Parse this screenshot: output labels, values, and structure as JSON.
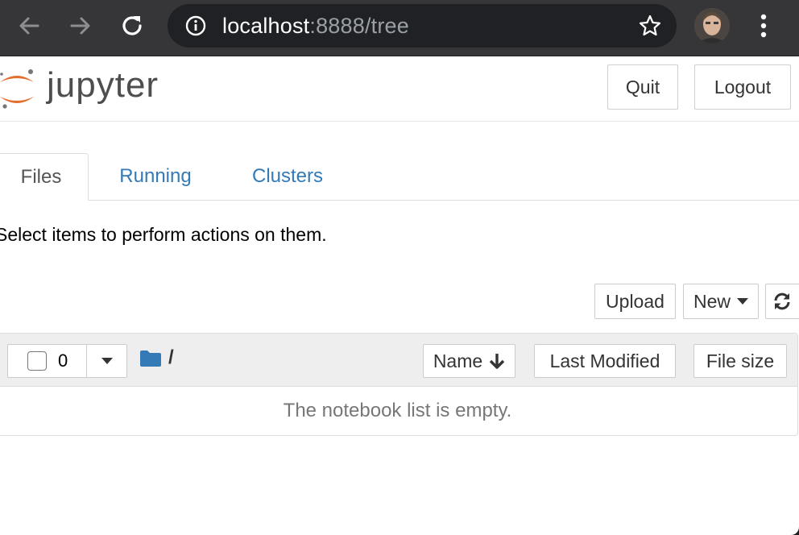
{
  "browser": {
    "url_host": "localhost",
    "url_path": ":8888/tree",
    "icons": {
      "back": "back-arrow-icon",
      "forward": "forward-arrow-icon",
      "reload": "reload-icon",
      "info": "info-icon",
      "star": "star-icon",
      "menu": "kebab-menu-icon"
    }
  },
  "header": {
    "logo_text": "jupyter",
    "quit_label": "Quit",
    "logout_label": "Logout"
  },
  "tabs": [
    {
      "label": "Files",
      "active": true
    },
    {
      "label": "Running",
      "active": false
    },
    {
      "label": "Clusters",
      "active": false
    }
  ],
  "main": {
    "select_message": "Select items to perform actions on them.",
    "upload_label": "Upload",
    "new_label": "New",
    "list": {
      "selected_count": "0",
      "breadcrumb_root": "/",
      "sort_name_label": "Name",
      "sort_modified_label": "Last Modified",
      "sort_size_label": "File size",
      "empty_message": "The notebook list is empty."
    }
  },
  "colors": {
    "link_blue": "#337ab7",
    "folder_blue": "#337ab7",
    "jupyter_orange": "#e46e2e",
    "toolbar_dark": "#363638"
  }
}
